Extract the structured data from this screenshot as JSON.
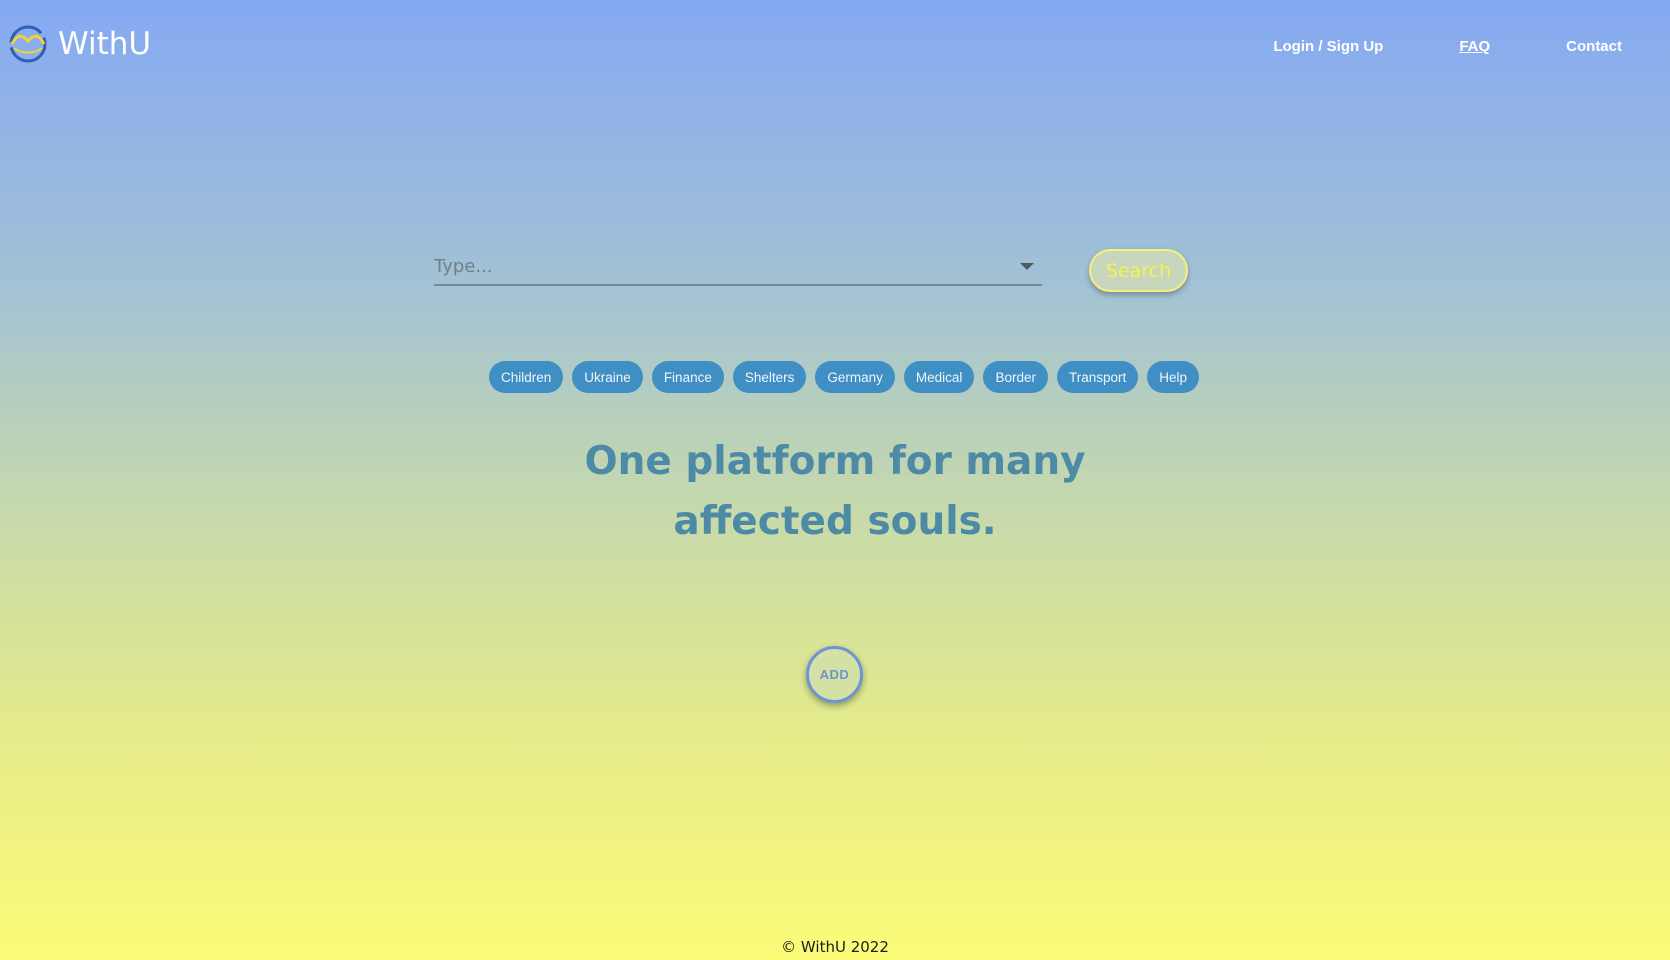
{
  "app": {
    "name": "WithU",
    "logo_icon": "wave-circle-logo-icon"
  },
  "nav": {
    "login": "Login / Sign Up",
    "faq": "FAQ",
    "contact": "Contact"
  },
  "search": {
    "placeholder": "Type...",
    "value": "",
    "button_label": "Search",
    "dropdown_icon": "triangle-down-icon"
  },
  "chips": [
    {
      "label": "Children"
    },
    {
      "label": "Ukraine"
    },
    {
      "label": "Finance"
    },
    {
      "label": "Shelters"
    },
    {
      "label": "Germany"
    },
    {
      "label": "Medical"
    },
    {
      "label": "Border"
    },
    {
      "label": "Transport"
    },
    {
      "label": "Help"
    }
  ],
  "tagline": "One platform for many affected souls.",
  "add_button": {
    "label": "ADD"
  },
  "footer": {
    "copyright": "© WithU 2022"
  },
  "colors": {
    "gradient_top": "#85a9f2",
    "gradient_bottom": "#fcfb78",
    "chip": "#3f8fc4",
    "tagline": "#4d8aa5",
    "search_accent": "#f7f24e"
  }
}
